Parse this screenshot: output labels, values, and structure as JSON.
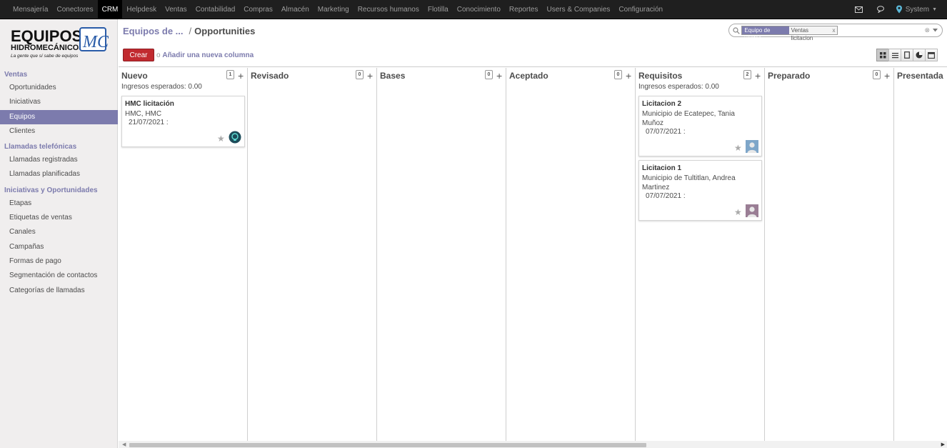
{
  "topbar": {
    "menu": [
      "Mensajería",
      "Conectores",
      "CRM",
      "Helpdesk",
      "Ventas",
      "Contabilidad",
      "Compras",
      "Almacén",
      "Marketing",
      "Recursos humanos",
      "Flotilla",
      "Conocimiento",
      "Reportes",
      "Users & Companies",
      "Configuración"
    ],
    "active": "CRM",
    "user": "System"
  },
  "logo": {
    "line1": "EQUIPOS",
    "line2": "HIDROMECÁNICOS",
    "tagline": "La gente que sí sabe de equipos",
    "mark": "MC"
  },
  "sidebar": {
    "sections": [
      {
        "title": "Ventas",
        "items": [
          "Oportunidades",
          "Iniciativas",
          "Equipos",
          "Clientes"
        ]
      },
      {
        "title": "Llamadas telefónicas",
        "items": [
          "Llamadas registradas",
          "Llamadas planificadas"
        ]
      },
      {
        "title": "Iniciativas y Oportunidades",
        "items": [
          "Etapas",
          "Etiquetas de ventas",
          "Canales",
          "Campañas",
          "Formas de pago",
          "Segmentación de contactos",
          "Categorías de llamadas"
        ]
      }
    ],
    "active_item": "Equipos"
  },
  "breadcrumb": {
    "parent": "Equipos de ...",
    "separator": "/",
    "current": "Opportunities"
  },
  "actions": {
    "create_label": "Crear",
    "or_label": "o",
    "add_column_label": "Añadir una nueva columna"
  },
  "search": {
    "facet_category": "Equipo de ventas",
    "facet_value": "Ventas licitacion",
    "facet_remove": "x",
    "value": "",
    "placeholder": ""
  },
  "views": [
    "kanban",
    "list",
    "form",
    "graph",
    "calendar"
  ],
  "columns": [
    {
      "name": "Nuevo",
      "count": "1",
      "income": "Ingresos esperados: 0.00",
      "cards": [
        {
          "title": "HMC licitación",
          "subtitle": "HMC, HMC",
          "date": "21/07/2021 :",
          "avatar": "default-icon"
        }
      ]
    },
    {
      "name": "Revisado",
      "count": "0",
      "income": "",
      "cards": []
    },
    {
      "name": "Bases",
      "count": "0",
      "income": "",
      "cards": []
    },
    {
      "name": "Aceptado",
      "count": "0",
      "income": "",
      "cards": []
    },
    {
      "name": "Requisitos",
      "count": "2",
      "income": "Ingresos esperados: 0.00",
      "cards": [
        {
          "title": "Licitacion 2",
          "subtitle": "Municipio de Ecatepec, Tania Muñoz",
          "date": "07/07/2021 :",
          "avatar": "user-avatar-blue"
        },
        {
          "title": "Licitacion 1",
          "subtitle": "Municipio de Tultitlan, Andrea Martinez",
          "date": "07/07/2021 :",
          "avatar": "user-avatar-purple"
        }
      ]
    },
    {
      "name": "Preparado",
      "count": "0",
      "income": "",
      "cards": []
    },
    {
      "name": "Presentada",
      "count": "",
      "income": "",
      "cards": []
    }
  ],
  "colors": {
    "accent": "#7c7bad",
    "create": "#c12a2f",
    "topbar": "#1f1f1f",
    "sidebar": "#f0eeee"
  }
}
